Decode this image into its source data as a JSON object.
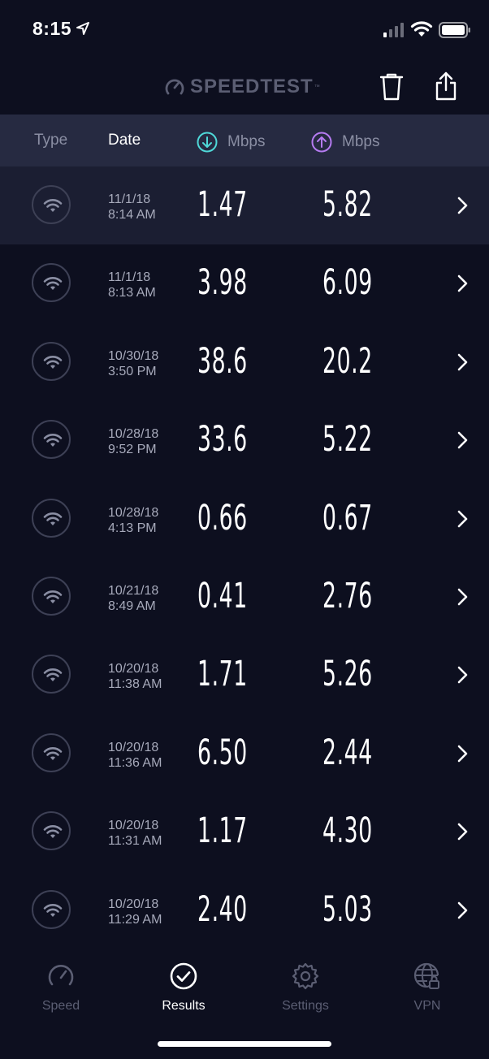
{
  "status_bar": {
    "time": "8:15"
  },
  "header": {
    "logo_text": "SPEEDTEST",
    "logo_tm": "™"
  },
  "columns": {
    "type": "Type",
    "date": "Date",
    "download_unit": "Mbps",
    "upload_unit": "Mbps"
  },
  "colors": {
    "download_accent": "#4fd8d8",
    "upload_accent": "#b57bf1",
    "background": "#0d0f1f",
    "header_band": "#262a41"
  },
  "results": [
    {
      "date": "11/1/18",
      "time": "8:14 AM",
      "download": "1.47",
      "upload": "5.82",
      "selected": true
    },
    {
      "date": "11/1/18",
      "time": "8:13 AM",
      "download": "3.98",
      "upload": "6.09"
    },
    {
      "date": "10/30/18",
      "time": "3:50 PM",
      "download": "38.6",
      "upload": "20.2"
    },
    {
      "date": "10/28/18",
      "time": "9:52 PM",
      "download": "33.6",
      "upload": "5.22"
    },
    {
      "date": "10/28/18",
      "time": "4:13 PM",
      "download": "0.66",
      "upload": "0.67"
    },
    {
      "date": "10/21/18",
      "time": "8:49 AM",
      "download": "0.41",
      "upload": "2.76"
    },
    {
      "date": "10/20/18",
      "time": "11:38 AM",
      "download": "1.71",
      "upload": "5.26"
    },
    {
      "date": "10/20/18",
      "time": "11:36 AM",
      "download": "6.50",
      "upload": "2.44"
    },
    {
      "date": "10/20/18",
      "time": "11:31 AM",
      "download": "1.17",
      "upload": "4.30"
    },
    {
      "date": "10/20/18",
      "time": "11:29 AM",
      "download": "2.40",
      "upload": "5.03"
    }
  ],
  "tabs": [
    {
      "label": "Speed",
      "icon": "gauge-icon"
    },
    {
      "label": "Results",
      "icon": "check-circle-icon",
      "active": true
    },
    {
      "label": "Settings",
      "icon": "gear-icon"
    },
    {
      "label": "VPN",
      "icon": "globe-lock-icon"
    }
  ]
}
